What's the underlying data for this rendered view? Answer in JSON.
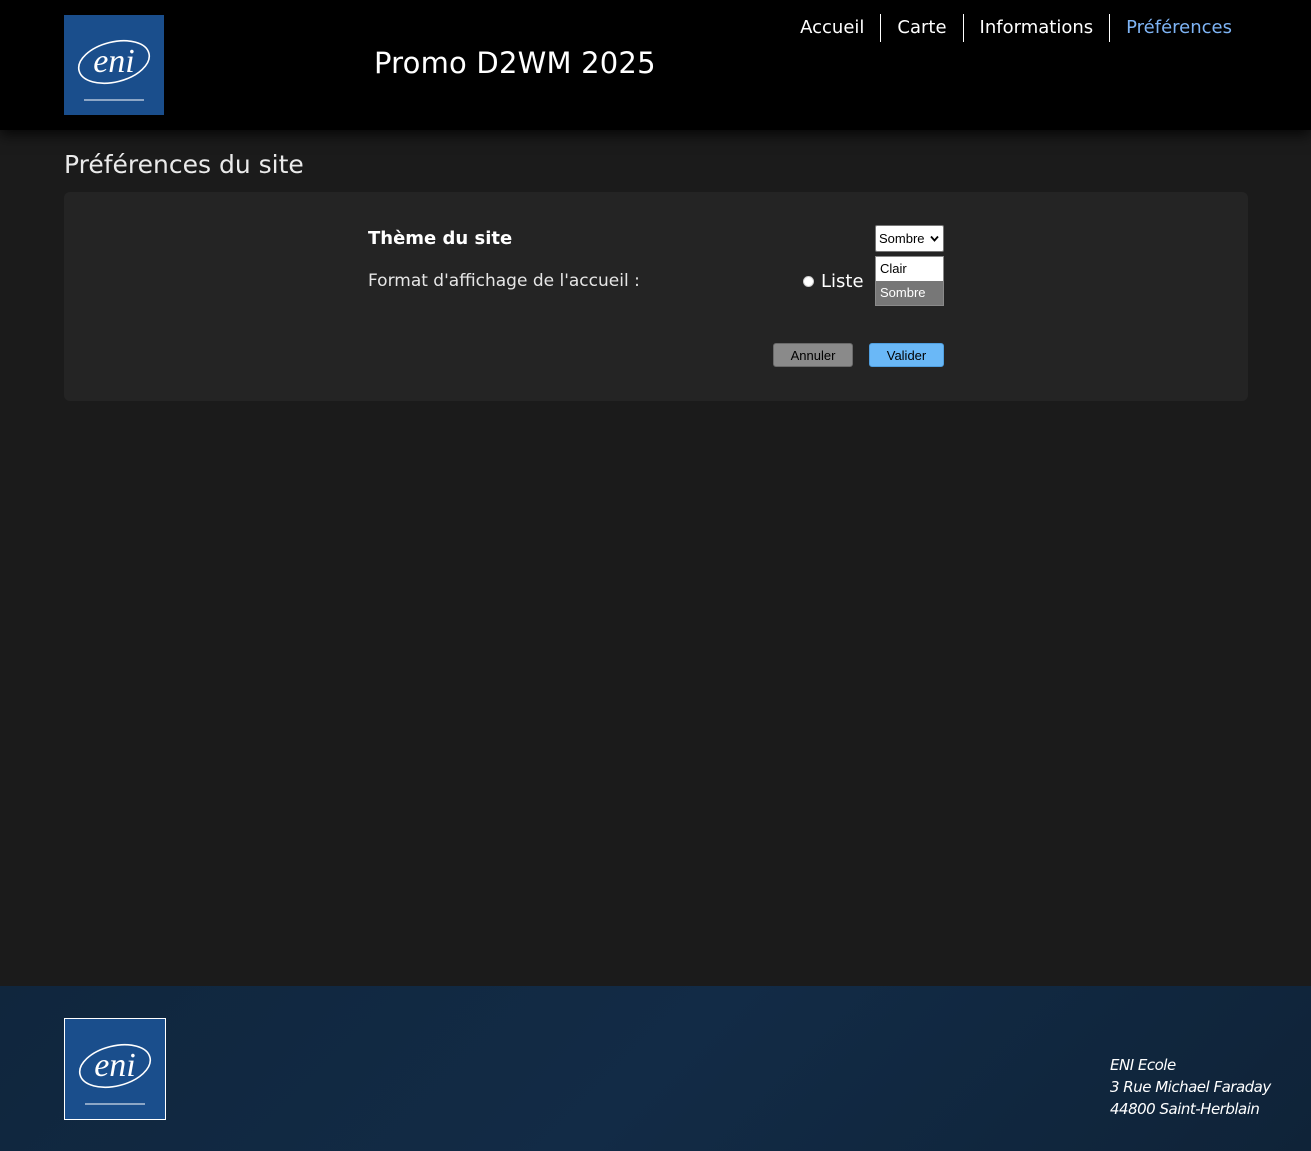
{
  "header": {
    "logo_text": "eni",
    "site_title": "Promo D2WM 2025",
    "nav": [
      {
        "label": "Accueil"
      },
      {
        "label": "Carte"
      },
      {
        "label": "Informations"
      },
      {
        "label": "Préférences",
        "active": true
      }
    ]
  },
  "main": {
    "page_title": "Préférences du site",
    "theme_label": "Thème du site",
    "theme_select": {
      "value": "Sombre",
      "options": [
        "Clair",
        "Sombre"
      ],
      "selected_option": "Sombre"
    },
    "format_label": "Format d'affichage de l'accueil :",
    "format_radio_label": "Liste",
    "cancel_label": "Annuler",
    "submit_label": "Valider"
  },
  "footer": {
    "logo_text": "eni",
    "address": [
      "ENI Ecole",
      "3 Rue Michael Faraday",
      "44800 Saint-Herblain"
    ]
  },
  "colors": {
    "header_bg": "#000000",
    "page_bg": "#1b1b1b",
    "panel_bg": "#242424",
    "nav_active": "#7eb4f5",
    "logo_blue": "#1a4e8c",
    "submit_button": "#6ab8f7",
    "cancel_button": "#8a8a8a",
    "footer_bg": "#122b46"
  }
}
